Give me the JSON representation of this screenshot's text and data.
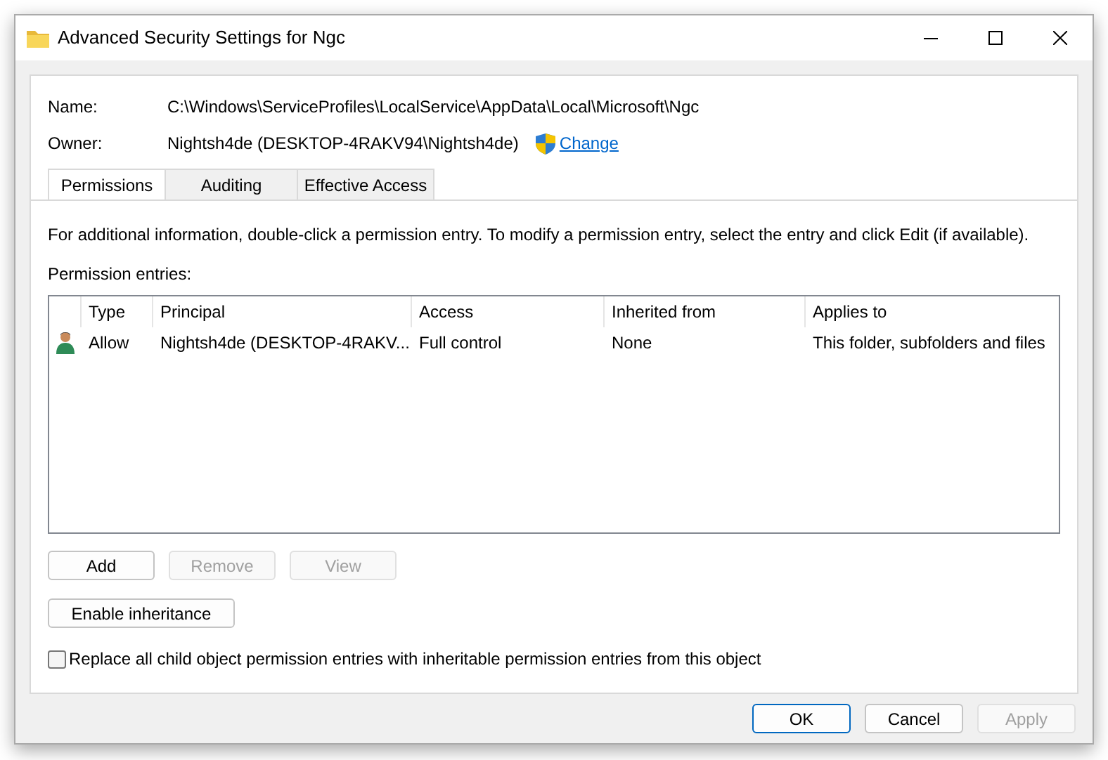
{
  "window": {
    "title": "Advanced Security Settings for Ngc"
  },
  "fields": [
    {
      "label": "Name:",
      "value": "C:\\Windows\\ServiceProfiles\\LocalService\\AppData\\Local\\Microsoft\\Ngc"
    },
    {
      "label": "Owner:",
      "value": "Nightsh4de (DESKTOP-4RAKV94\\Nightsh4de)",
      "link": "Change"
    }
  ],
  "tabs": [
    {
      "label": "Permissions",
      "selected": true
    },
    {
      "label": "Auditing",
      "selected": false
    },
    {
      "label": "Effective Access",
      "selected": false
    }
  ],
  "info": "For additional information, double-click a permission entry. To modify a permission entry, select the entry and click Edit (if available).",
  "table": {
    "caption": "Permission entries:",
    "columns": [
      "Type",
      "Principal",
      "Access",
      "Inherited from",
      "Applies to"
    ],
    "rows": [
      [
        "Allow",
        "Nightsh4de (DESKTOP-4RAKV...",
        "Full control",
        "None",
        "This folder, subfolders and files"
      ]
    ]
  },
  "entry_buttons": [
    {
      "label": "Add",
      "disabled": false
    },
    {
      "label": "Remove",
      "disabled": true
    },
    {
      "label": "View",
      "disabled": true
    }
  ],
  "inheritance_button": {
    "label": "Enable inheritance",
    "disabled": false
  },
  "replace_checkbox": {
    "label": "Replace all child object permission entries with inheritable permission entries from this object",
    "checked": false
  },
  "dialog_buttons": [
    {
      "label": "OK",
      "disabled": false,
      "default": true
    },
    {
      "label": "Cancel",
      "disabled": false,
      "default": false
    },
    {
      "label": "Apply",
      "disabled": true,
      "default": false
    }
  ]
}
